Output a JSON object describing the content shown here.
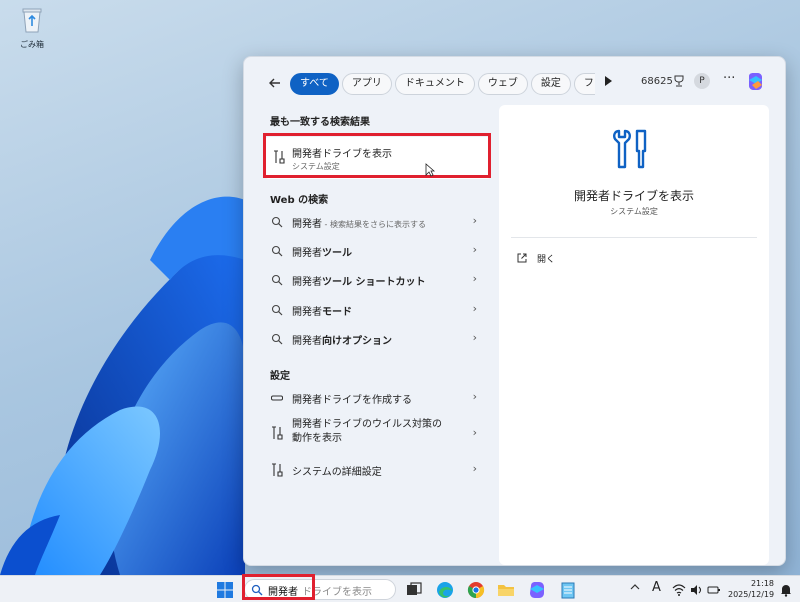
{
  "desktop": {
    "recycle_bin_label": "ごみ箱"
  },
  "toolbar": {
    "tabs": [
      "すべて",
      "アプリ",
      "ドキュメント",
      "ウェブ",
      "設定",
      "フォル"
    ],
    "active_tab": 0,
    "points": "68625",
    "avatar_letter": "P",
    "more": "···"
  },
  "best_match": {
    "heading": "最も一致する検索結果",
    "title": "開発者ドライブを表示",
    "subtitle": "システム設定"
  },
  "web_search": {
    "heading": "Web の検索",
    "items": [
      {
        "prefix": "開発者",
        "bold": "",
        "suffix": " - 検索結果をさらに表示する"
      },
      {
        "prefix": "開発者",
        "bold": "ツール",
        "suffix": ""
      },
      {
        "prefix": "開発者",
        "bold": "ツール ショートカット",
        "suffix": ""
      },
      {
        "prefix": "開発者",
        "bold": "モード",
        "suffix": ""
      },
      {
        "prefix": "開発者",
        "bold": "向けオプション",
        "suffix": ""
      }
    ]
  },
  "settings": {
    "heading": "設定",
    "items": [
      {
        "line1": "開発者ドライブを作成する",
        "line2": ""
      },
      {
        "line1": "開発者ドライブのウイルス対策の",
        "line2": "動作を表示"
      },
      {
        "line1": "システムの詳細設定",
        "line2": ""
      }
    ]
  },
  "detail": {
    "title": "開発者ドライブを表示",
    "subtitle": "システム設定",
    "open_label": "開く"
  },
  "taskbar": {
    "search_typed": "開発者",
    "search_hint": "ドライブを表示",
    "ime": "A",
    "time": "21:18",
    "date": "2025/12/19"
  },
  "colors": {
    "accent": "#0f62c4",
    "highlight": "#e0202f"
  }
}
